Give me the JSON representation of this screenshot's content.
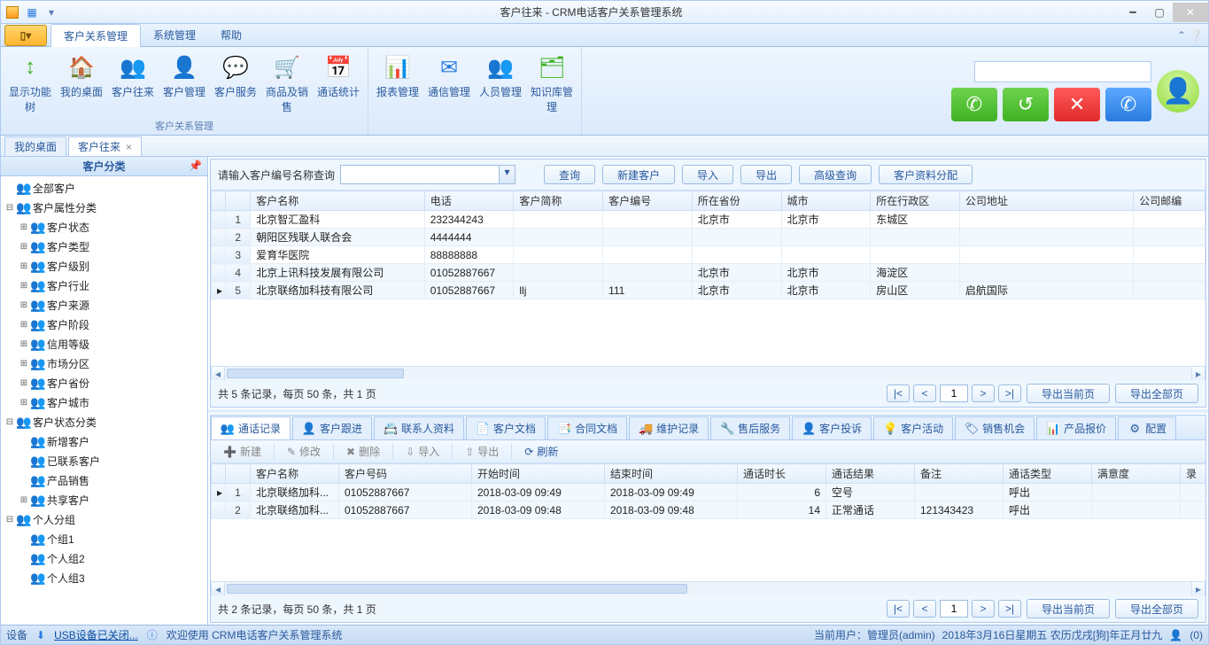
{
  "title": "客户往来 - CRM电话客户关系管理系统",
  "menu_tabs": [
    "客户关系管理",
    "系统管理",
    "帮助"
  ],
  "ribbon_groups": [
    {
      "label": "客户关系管理",
      "items": [
        {
          "icon": "↕",
          "label": "显示功能树",
          "color": "#3fb223"
        },
        {
          "icon": "🏠",
          "label": "我的桌面",
          "color": "#ff8a2b"
        },
        {
          "icon": "👥",
          "label": "客户往来",
          "color": "#ff8a2b"
        },
        {
          "icon": "👤",
          "label": "客户管理",
          "color": "#ff8a2b"
        },
        {
          "icon": "💬",
          "label": "客户服务",
          "color": "#ffb42f"
        },
        {
          "icon": "🛒",
          "label": "商品及销售",
          "color": "#3fb223"
        },
        {
          "icon": "📅",
          "label": "通话统计",
          "color": "#2a7be0"
        }
      ]
    },
    {
      "label": "",
      "items": [
        {
          "icon": "📊",
          "label": "报表管理",
          "color": "#ff5a5a"
        },
        {
          "icon": "✉",
          "label": "通信管理",
          "color": "#2a7be0"
        },
        {
          "icon": "👥",
          "label": "人员管理",
          "color": "#ffb42f"
        },
        {
          "icon": "🗂",
          "label": "知识库管理",
          "color": "#3fb223"
        }
      ]
    }
  ],
  "doc_tabs": [
    {
      "label": "我的桌面",
      "closable": false,
      "active": false
    },
    {
      "label": "客户往来",
      "closable": true,
      "active": true
    }
  ],
  "sidebar_title": "客户分类",
  "tree": [
    {
      "d": 0,
      "exp": "",
      "ico": "👥",
      "lbl": "全部客户"
    },
    {
      "d": 0,
      "exp": "⊟",
      "ico": "👥",
      "lbl": "客户属性分类"
    },
    {
      "d": 1,
      "exp": "⊞",
      "ico": "👥",
      "lbl": "客户状态"
    },
    {
      "d": 1,
      "exp": "⊞",
      "ico": "👥",
      "lbl": "客户类型"
    },
    {
      "d": 1,
      "exp": "⊞",
      "ico": "👥",
      "lbl": "客户级别"
    },
    {
      "d": 1,
      "exp": "⊞",
      "ico": "👥",
      "lbl": "客户行业"
    },
    {
      "d": 1,
      "exp": "⊞",
      "ico": "👥",
      "lbl": "客户来源"
    },
    {
      "d": 1,
      "exp": "⊞",
      "ico": "👥",
      "lbl": "客户阶段"
    },
    {
      "d": 1,
      "exp": "⊞",
      "ico": "👥",
      "lbl": "信用等级"
    },
    {
      "d": 1,
      "exp": "⊞",
      "ico": "👥",
      "lbl": "市场分区"
    },
    {
      "d": 1,
      "exp": "⊞",
      "ico": "👥",
      "lbl": "客户省份"
    },
    {
      "d": 1,
      "exp": "⊞",
      "ico": "👥",
      "lbl": "客户城市"
    },
    {
      "d": 0,
      "exp": "⊟",
      "ico": "👥",
      "lbl": "客户状态分类"
    },
    {
      "d": 1,
      "exp": "",
      "ico": "👥",
      "lbl": "新增客户"
    },
    {
      "d": 1,
      "exp": "",
      "ico": "👥",
      "lbl": "已联系客户"
    },
    {
      "d": 1,
      "exp": "",
      "ico": "👥",
      "lbl": "产品销售"
    },
    {
      "d": 1,
      "exp": "⊞",
      "ico": "👥",
      "lbl": "共享客户"
    },
    {
      "d": 0,
      "exp": "⊟",
      "ico": "👥",
      "lbl": "个人分组"
    },
    {
      "d": 1,
      "exp": "",
      "ico": "👥",
      "lbl": "个组1"
    },
    {
      "d": 1,
      "exp": "",
      "ico": "👥",
      "lbl": "个人组2"
    },
    {
      "d": 1,
      "exp": "",
      "ico": "👥",
      "lbl": "个人组3"
    }
  ],
  "search_label": "请输入客户编号名称查询",
  "top_buttons": [
    "查询",
    "新建客户",
    "导入",
    "导出",
    "高级查询",
    "客户资料分配"
  ],
  "top_cols": [
    "客户名称",
    "电话",
    "客户简称",
    "客户编号",
    "所在省份",
    "城市",
    "所在行政区",
    "公司地址",
    "公司邮编"
  ],
  "top_rows": [
    {
      "n": "1",
      "cells": [
        "北京智汇盈科",
        "232344243",
        "",
        "",
        "北京市",
        "北京市",
        "东城区",
        "",
        ""
      ]
    },
    {
      "n": "2",
      "cells": [
        "朝阳区残联人联合会",
        "4444444",
        "",
        "",
        "",
        "",
        "",
        "",
        ""
      ]
    },
    {
      "n": "3",
      "cells": [
        "爱育华医院",
        "88888888",
        "",
        "",
        "",
        "",
        "",
        "",
        ""
      ]
    },
    {
      "n": "4",
      "cells": [
        "北京上讯科技发展有限公司",
        "01052887667",
        "",
        "",
        "北京市",
        "北京市",
        "海淀区",
        "",
        ""
      ]
    },
    {
      "n": "5",
      "cells": [
        "北京联络加科技有限公司",
        "01052887667",
        "llj",
        "111",
        "北京市",
        "北京市",
        "房山区",
        "启航国际",
        ""
      ],
      "sel": true
    }
  ],
  "top_pager_text": "共 5 条记录，每页 50 条，共 1 页",
  "pager_page": "1",
  "top_export_buttons": [
    "导出当前页",
    "导出全部页"
  ],
  "sub_tabs": [
    {
      "ico": "👥",
      "lbl": "通话记录",
      "active": true
    },
    {
      "ico": "👤",
      "lbl": "客户跟进"
    },
    {
      "ico": "📇",
      "lbl": "联系人资料"
    },
    {
      "ico": "📄",
      "lbl": "客户文档"
    },
    {
      "ico": "📑",
      "lbl": "合同文档"
    },
    {
      "ico": "🚚",
      "lbl": "维护记录"
    },
    {
      "ico": "🔧",
      "lbl": "售后服务"
    },
    {
      "ico": "👤",
      "lbl": "客户投诉"
    },
    {
      "ico": "💡",
      "lbl": "客户活动"
    },
    {
      "ico": "🏷",
      "lbl": "销售机会"
    },
    {
      "ico": "📊",
      "lbl": "产品报价"
    },
    {
      "ico": "⚙",
      "lbl": "配置"
    }
  ],
  "sub_toolbar": [
    {
      "ico": "➕",
      "lbl": "新建",
      "en": false
    },
    {
      "ico": "✎",
      "lbl": "修改",
      "en": false
    },
    {
      "ico": "✖",
      "lbl": "删除",
      "en": false
    },
    {
      "ico": "⇩",
      "lbl": "导入",
      "en": false
    },
    {
      "ico": "⇧",
      "lbl": "导出",
      "en": false
    },
    {
      "ico": "⟳",
      "lbl": "刷新",
      "en": true
    }
  ],
  "bot_cols": [
    "客户名称",
    "客户号码",
    "开始时间",
    "结束时间",
    "通话时长",
    "通话结果",
    "备注",
    "通话类型",
    "满意度",
    "录"
  ],
  "bot_rows": [
    {
      "n": "1",
      "cells": [
        "北京联络加科...",
        "01052887667",
        "2018-03-09 09:49",
        "2018-03-09 09:49",
        "6",
        "空号",
        "",
        "呼出",
        "",
        ""
      ],
      "sel": true
    },
    {
      "n": "2",
      "cells": [
        "北京联络加科...",
        "01052887667",
        "2018-03-09 09:48",
        "2018-03-09 09:48",
        "14",
        "正常通话",
        "121343423",
        "呼出",
        "",
        ""
      ]
    }
  ],
  "bot_pager_text": "共 2 条记录，每页 50 条，共 1 页",
  "status": {
    "device": "设备",
    "usb": "USB设备已关闭...",
    "welcome": "欢迎使用 CRM电话客户关系管理系统",
    "user": "当前用户：管理员(admin)",
    "date": "2018年3月16日星期五 农历戊戌[狗]年正月廿九",
    "count": "(0)"
  }
}
